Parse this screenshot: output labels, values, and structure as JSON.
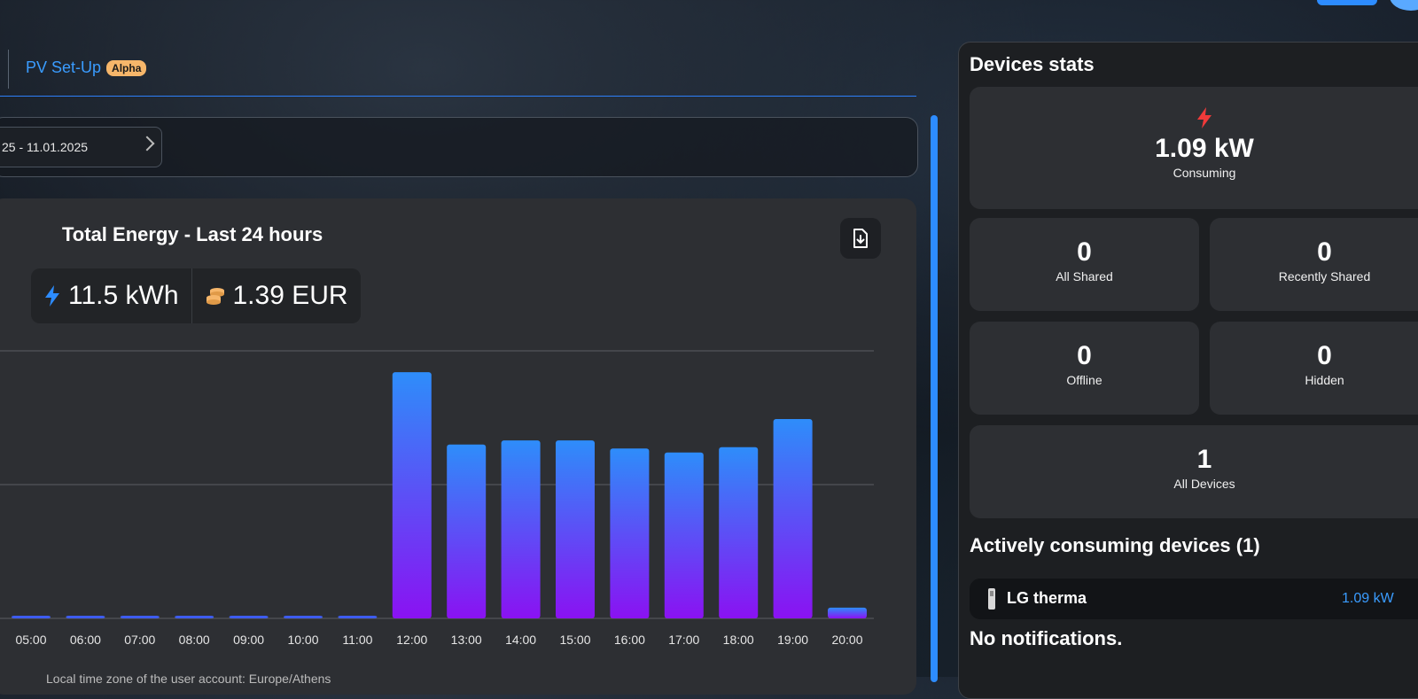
{
  "tabs": {
    "pv_setup": "PV Set-Up",
    "pv_badge": "Alpha"
  },
  "date_range": "25 - 11.01.2025",
  "energy_card": {
    "title": "Total Energy - Last 24 hours",
    "energy": "11.5 kWh",
    "cost": "1.39 EUR",
    "timezone_note": "Local time zone of the user account: Europe/Athens"
  },
  "chart_data": {
    "type": "bar",
    "categories": [
      "05:00",
      "06:00",
      "07:00",
      "08:00",
      "09:00",
      "10:00",
      "11:00",
      "12:00",
      "13:00",
      "14:00",
      "15:00",
      "16:00",
      "17:00",
      "18:00",
      "19:00",
      "20:00"
    ],
    "values": [
      0.02,
      0.02,
      0.02,
      0.02,
      0.02,
      0.02,
      0.02,
      1.84,
      1.3,
      1.33,
      1.33,
      1.27,
      1.24,
      1.28,
      1.49,
      0.08
    ],
    "ylim": [
      0,
      2
    ],
    "grid": true,
    "colors": {
      "top": "#2e8dfa",
      "bottom": "#8a12f2"
    }
  },
  "devices_stats": {
    "title": "Devices stats",
    "consuming": {
      "value": "1.09 kW",
      "label": "Consuming"
    },
    "all_shared": {
      "value": "0",
      "label": "All Shared"
    },
    "recently_shared": {
      "value": "0",
      "label": "Recently Shared"
    },
    "offline": {
      "value": "0",
      "label": "Offline"
    },
    "hidden": {
      "value": "0",
      "label": "Hidden"
    },
    "all_devices": {
      "value": "1",
      "label": "All Devices"
    }
  },
  "active_devices": {
    "title": "Actively consuming devices (1)",
    "items": [
      {
        "name": "LG therma",
        "power": "1.09 kW"
      }
    ]
  },
  "notifications": {
    "title": "No notifications."
  },
  "colors": {
    "accent": "#2d8cff",
    "consuming_icon": "#f03a3a",
    "coin": "#f6b66a"
  }
}
